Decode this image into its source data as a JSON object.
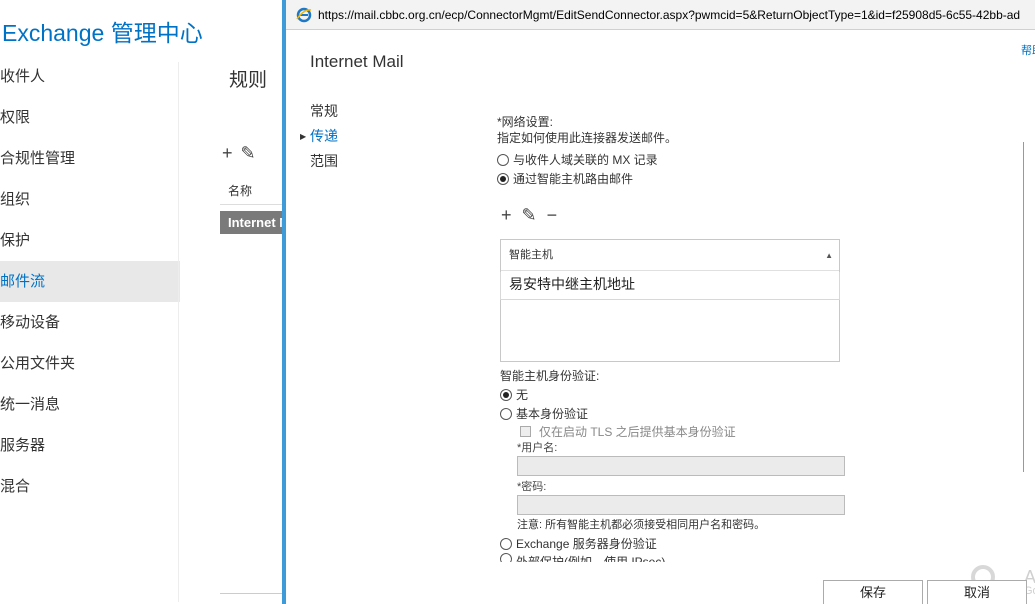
{
  "eac": {
    "title": "Exchange 管理中心",
    "nav": [
      "收件人",
      "权限",
      "合规性管理",
      "组织",
      "保护",
      "邮件流",
      "移动设备",
      "公用文件夹",
      "统一消息",
      "服务器",
      "混合"
    ],
    "active_nav_index": 5,
    "section_title": "规则",
    "tool_add": "+",
    "tool_edit": "✎",
    "column_name": "名称",
    "selected_row": "Internet Mail"
  },
  "popup": {
    "url_prefix": "https://mail.",
    "url_domain": "cbbc.org.cn",
    "url_rest": "/ecp/ConnectorMgmt/EditSendConnector.aspx?pwmcid=5&ReturnObjectType=1&id=f25908d5-6c55-42bb-ad",
    "help": "帮助",
    "title": "Internet Mail",
    "side": [
      "常规",
      "传递",
      "范围"
    ],
    "active_side_index": 1,
    "network": {
      "label": "*网络设置:",
      "desc": "指定如何使用此连接器发送邮件。",
      "option_mx": "与收件人域关联的 MX 记录",
      "option_smarthost": "通过智能主机路由邮件",
      "selected": "smarthost"
    },
    "host_tools": {
      "add": "+",
      "edit": "✎",
      "remove": "−"
    },
    "host_list": {
      "header": "智能主机",
      "rows": [
        "易安特中继主机地址"
      ]
    },
    "auth": {
      "label": "智能主机身份验证:",
      "option_none": "无",
      "option_basic": "基本身份验证",
      "tls_checkbox": "仅在启动 TLS 之后提供基本身份验证",
      "username_label": "*用户名:",
      "password_label": "*密码:",
      "note": "注意: 所有智能主机都必须接受相同用户名和密码。",
      "option_exchange": "Exchange 服务器身份验证",
      "option_external": "外部保护(例如，使用 IPsec)",
      "selected": "none"
    },
    "buttons": {
      "save": "保存",
      "cancel": "取消"
    },
    "watermark": {
      "line1": "Ac",
      "line2": "Go"
    }
  }
}
